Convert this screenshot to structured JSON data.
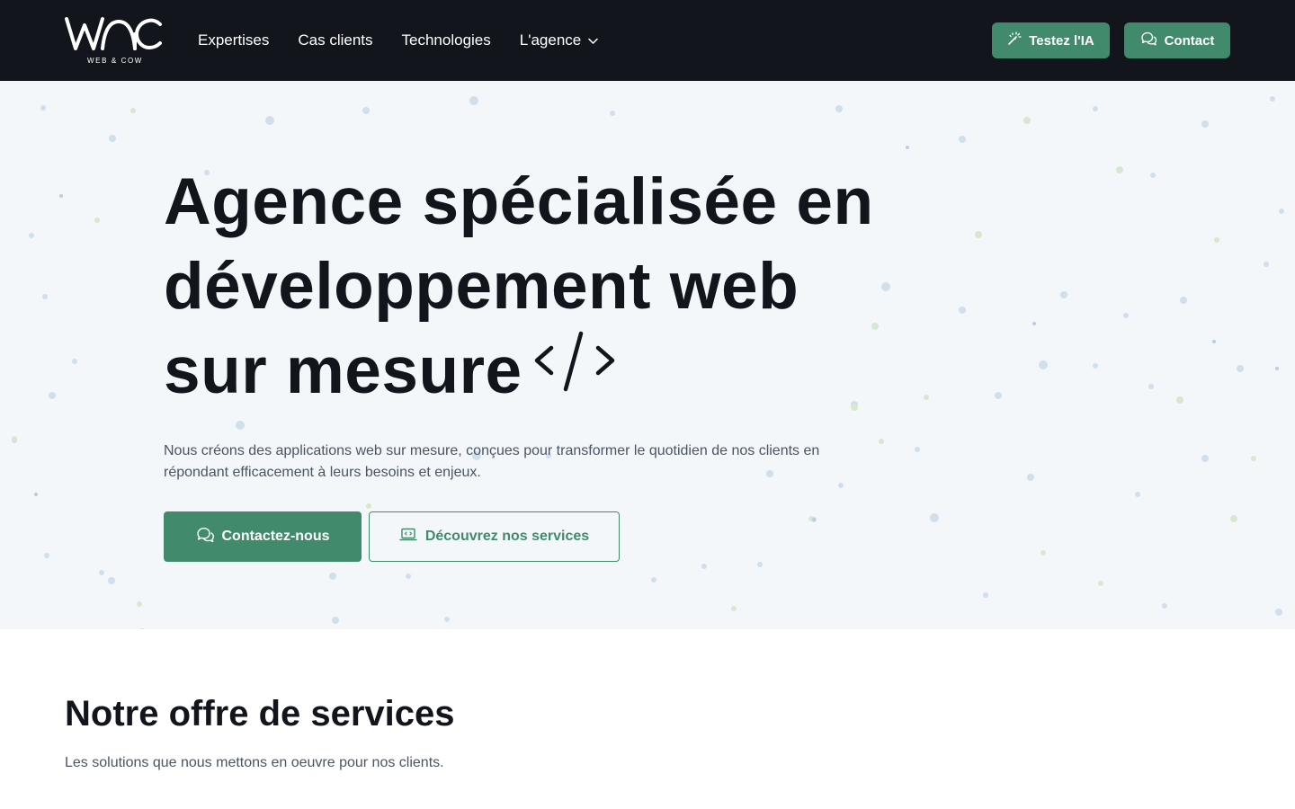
{
  "brand": {
    "logo_text": "WAC",
    "logo_subtitle": "WEB & COW"
  },
  "nav": {
    "items": [
      {
        "label": "Expertises"
      },
      {
        "label": "Cas clients"
      },
      {
        "label": "Technologies"
      },
      {
        "label": "L'agence",
        "has_dropdown": true
      }
    ]
  },
  "header_actions": {
    "ia_label": "Testez l'IA",
    "contact_label": "Contact"
  },
  "hero": {
    "title_line1": "Agence spécialisée en",
    "title_line2": "développement web",
    "title_line3": "sur mesure",
    "description": "Nous créons des applications web sur mesure, conçues pour transformer le quotidien de nos clients en répondant efficacement à leurs besoins et enjeux.",
    "primary_cta": "Contactez-nous",
    "secondary_cta": "Découvrez nos services"
  },
  "services": {
    "title": "Notre offre de services",
    "subtitle": "Les solutions que nous mettons en oeuvre pour nos clients."
  },
  "colors": {
    "header_bg": "#12161c",
    "accent": "#418b6c",
    "hero_bg": "#f3f7fa",
    "text": "#12161c",
    "muted": "#4a5563"
  },
  "icons": {
    "ia": "magic-wand-icon",
    "contact": "chat-bubbles-icon",
    "dropdown": "chevron-down-icon",
    "code": "code-icon",
    "services": "laptop-code-icon"
  }
}
